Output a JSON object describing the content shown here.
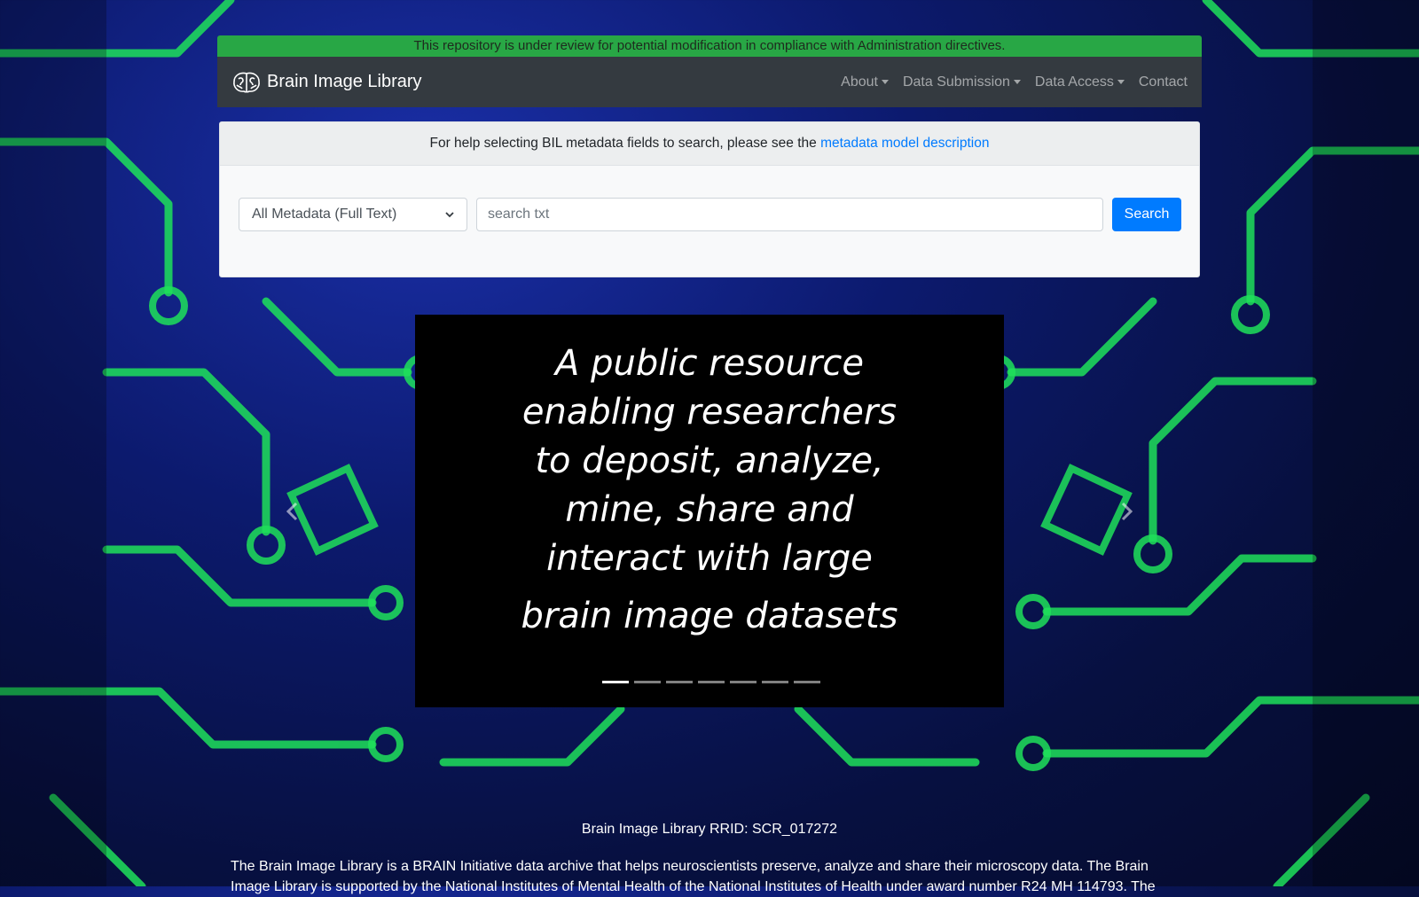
{
  "banner": "This repository is under review for potential modification in compliance with Administration directives.",
  "navbar": {
    "brand": "Brain Image Library",
    "links": [
      {
        "label": "About",
        "dropdown": true
      },
      {
        "label": "Data Submission",
        "dropdown": true
      },
      {
        "label": "Data Access",
        "dropdown": true
      },
      {
        "label": "Contact",
        "dropdown": false
      }
    ]
  },
  "search_card": {
    "help_text": "For help selecting BIL metadata fields to search, please see the",
    "help_link": "metadata model description",
    "select_value": "All Metadata (Full Text)",
    "input_placeholder": "search txt",
    "button_label": "Search"
  },
  "carousel": {
    "lines": [
      "A public resource",
      "enabling researchers",
      "to deposit, analyze,",
      "mine, share and",
      "interact with large"
    ],
    "last_line": "brain image datasets",
    "slide_count": 7,
    "active_slide": 1,
    "prev_label": "Previous",
    "next_label": "Next"
  },
  "rrid": "Brain Image Library RRID: SCR_017272",
  "about_text": "The Brain Image Library is a BRAIN Initiative data archive that helps neuroscientists preserve, analyze and share their microscopy data. The Brain Image Library is supported by the National Institutes of Mental Health of the National Institutes of Health under award number R24 MH 114793. The",
  "colors": {
    "banner": "#28a745",
    "navbar": "#343a40",
    "primary": "#007bff",
    "circuit": "#1fe05a"
  }
}
